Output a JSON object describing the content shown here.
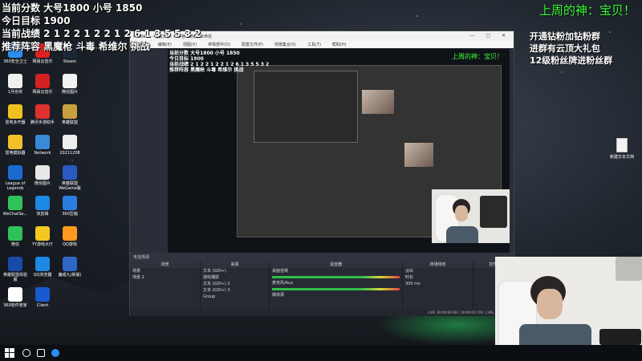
{
  "overlay_left": {
    "line1": "当前分数 大号1800 小号 1850",
    "line2": "今日目标 1900",
    "line3": "当前战绩 2 1 2 2 1 2 2 1 2 6 1 3 5 5 3 2",
    "line4": "推荐阵容 黑魔枪 斗毒 希维尔 挑战"
  },
  "overlay_right": {
    "banner": "上周的神：宝贝！",
    "line1": "开通钻粉加钻粉群",
    "line2": "进群有云顶大礼包",
    "line3": "12级粉丝牌进粉丝群"
  },
  "desktop_icons": [
    {
      "label": "360安全卫士",
      "color": "#2a8ef0"
    },
    {
      "label": "网易云音乐",
      "color": "#e02020"
    },
    {
      "label": "Steam",
      "color": "#1b2838"
    },
    {
      "label": "1月份奖",
      "color": "#f0f0f0"
    },
    {
      "label": "网易云音乐",
      "color": "#d32020"
    },
    {
      "label": "微信图片",
      "color": "#f2f2f2"
    },
    {
      "label": "雷电多开器",
      "color": "#f0c020"
    },
    {
      "label": "腾讯手游助手",
      "color": "#e03030"
    },
    {
      "label": "英雄联盟",
      "color": "#c8a040"
    },
    {
      "label": "雷电模拟器",
      "color": "#f2c02a"
    },
    {
      "label": "Network",
      "color": "#3a8ad8"
    },
    {
      "label": "20211208",
      "color": "#eeeeee"
    },
    {
      "label": "League of Legends",
      "color": "#1a6ad0"
    },
    {
      "label": "微信图片",
      "color": "#e8e8e8"
    },
    {
      "label": "英雄联盟WeGame版",
      "color": "#2a5ac0"
    },
    {
      "label": "WeChatSe...",
      "color": "#2fc25b"
    },
    {
      "label": "快剪辑",
      "color": "#1e88e5"
    },
    {
      "label": "360压缩",
      "color": "#2b7de0"
    },
    {
      "label": "微信",
      "color": "#2fc25b"
    },
    {
      "label": "YY游戏大厅",
      "color": "#f4c81e"
    },
    {
      "label": "QQ游戏",
      "color": "#ff9a1e"
    },
    {
      "label": "英雄联盟体验服",
      "color": "#1a4aa8"
    },
    {
      "label": "QQ浏览器",
      "color": "#1e88e5"
    },
    {
      "label": "魔戒九(新版)",
      "color": "#3066c8"
    },
    {
      "label": "360软件管家",
      "color": "#ffffff"
    },
    {
      "label": "Client",
      "color": "#1a5ad0"
    }
  ],
  "desktop_right_icon": {
    "label": "新建文本文档"
  },
  "obs": {
    "title": "windows - 配置文件: 未命名 - 场景: 未命名",
    "menu": [
      "文件(F)",
      "编辑(E)",
      "视图(V)",
      "停靠部件(D)",
      "配置文件(P)",
      "场景集合(S)",
      "工具(T)",
      "帮助(H)"
    ],
    "scene_bar": "未选择源",
    "docks": {
      "scenes": {
        "header": "场景",
        "items": [
          "场景",
          "场景 2"
        ]
      },
      "sources": {
        "header": "来源",
        "items": [
          "文本 (GDI+)",
          "游戏捕获",
          "文本 (GDI+) 2",
          "文本 (GDI+) 3",
          "Group"
        ]
      },
      "mixer": {
        "header": "混音器",
        "items": [
          "桌面音频",
          "麦克风/Aux",
          "媒体源"
        ]
      },
      "transitions": {
        "header": "转场特效",
        "items": [
          "淡出",
          "时长",
          "300 ms"
        ]
      },
      "controls": {
        "header": "控件"
      }
    },
    "status": "LIVE: 00:00:00   REC: 00:00:00   CPU: 2.8%, 60.00 fps"
  },
  "taskbar": {
    "icons": [
      "start",
      "search",
      "task-view",
      "browser"
    ]
  }
}
